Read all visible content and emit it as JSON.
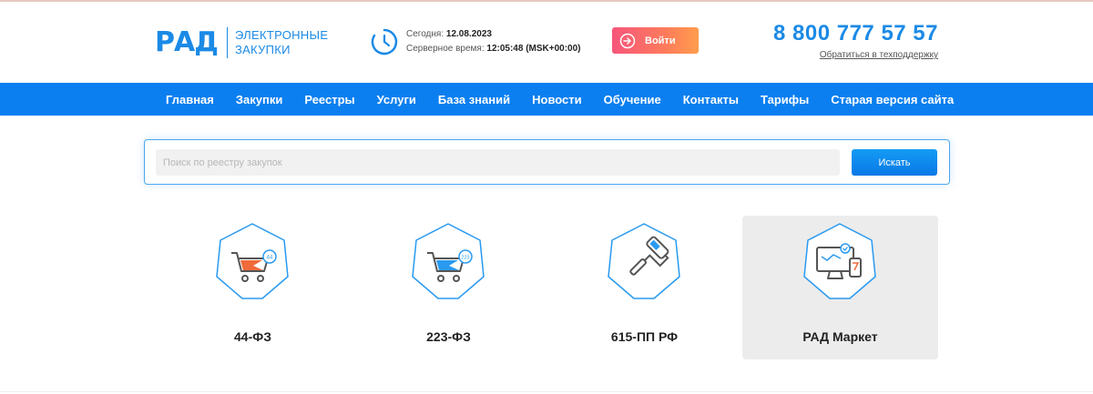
{
  "header": {
    "logo": {
      "mark": "РАД",
      "text_line1": "ЭЛЕКТРОННЫЕ",
      "text_line2": "ЗАКУПКИ"
    },
    "date_label": "Сегодня:",
    "date_value": "12.08.2023",
    "server_time_label": "Серверное время:",
    "server_time_value": "12:05:48 (MSK+00:00)",
    "login_label": "Войти",
    "phone": "8 800 777 57 57",
    "support_link": "Обратиться в техподдержку"
  },
  "nav": {
    "items": [
      "Главная",
      "Закупки",
      "Реестры",
      "Услуги",
      "База знаний",
      "Новости",
      "Обучение",
      "Контакты",
      "Тарифы",
      "Старая версия сайта"
    ]
  },
  "search": {
    "placeholder": "Поиск по реестру закупок",
    "value": "",
    "button_label": "Искать"
  },
  "cards": [
    {
      "label": "44-ФЗ",
      "icon": "cart-44-icon",
      "badge": "44",
      "selected": false
    },
    {
      "label": "223-ФЗ",
      "icon": "cart-223-icon",
      "badge": "223",
      "selected": false
    },
    {
      "label": "615-ПП РФ",
      "icon": "paint-roller-icon",
      "selected": false
    },
    {
      "label": "РАД Маркет",
      "icon": "devices-icon",
      "selected": true
    }
  ],
  "colors": {
    "brand_blue": "#0b7ff0",
    "login_gradient_start": "#f7567c",
    "login_gradient_end": "#ff9d4d",
    "card_selected_bg": "#ececec"
  }
}
